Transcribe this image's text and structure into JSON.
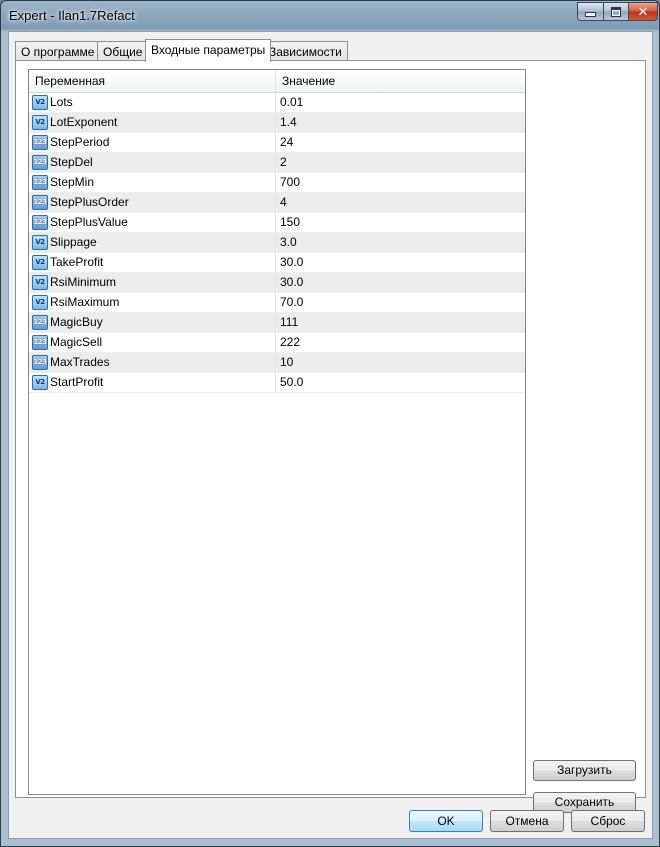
{
  "window": {
    "title": "Expert - Ilan1.7Refact"
  },
  "tabs": [
    {
      "label": "О программе"
    },
    {
      "label": "Общие"
    },
    {
      "label": "Входные параметры"
    },
    {
      "label": "Зависимости"
    }
  ],
  "grid": {
    "col_variable": "Переменная",
    "col_value": "Значение",
    "rows": [
      {
        "name": "Lots",
        "value": "0.01",
        "icon": "double-value-icon"
      },
      {
        "name": "LotExponent",
        "value": "1.4",
        "icon": "double-value-icon"
      },
      {
        "name": "StepPeriod",
        "value": "24",
        "icon": "integer-value-icon"
      },
      {
        "name": "StepDel",
        "value": "2",
        "icon": "integer-value-icon"
      },
      {
        "name": "StepMin",
        "value": "700",
        "icon": "integer-value-icon"
      },
      {
        "name": "StepPlusOrder",
        "value": "4",
        "icon": "integer-value-icon"
      },
      {
        "name": "StepPlusValue",
        "value": "150",
        "icon": "integer-value-icon"
      },
      {
        "name": "Slippage",
        "value": "3.0",
        "icon": "double-value-icon"
      },
      {
        "name": "TakeProfit",
        "value": "30.0",
        "icon": "double-value-icon"
      },
      {
        "name": "RsiMinimum",
        "value": "30.0",
        "icon": "double-value-icon"
      },
      {
        "name": "RsiMaximum",
        "value": "70.0",
        "icon": "double-value-icon"
      },
      {
        "name": "MagicBuy",
        "value": "111",
        "icon": "integer-value-icon"
      },
      {
        "name": "MagicSell",
        "value": "222",
        "icon": "integer-value-icon"
      },
      {
        "name": "MaxTrades",
        "value": "10",
        "icon": "integer-value-icon"
      },
      {
        "name": "StartProfit",
        "value": "50.0",
        "icon": "double-value-icon"
      }
    ]
  },
  "buttons": {
    "load": "Загрузить",
    "save": "Сохранить",
    "ok": "OK",
    "cancel": "Отмена",
    "reset": "Сброс"
  }
}
